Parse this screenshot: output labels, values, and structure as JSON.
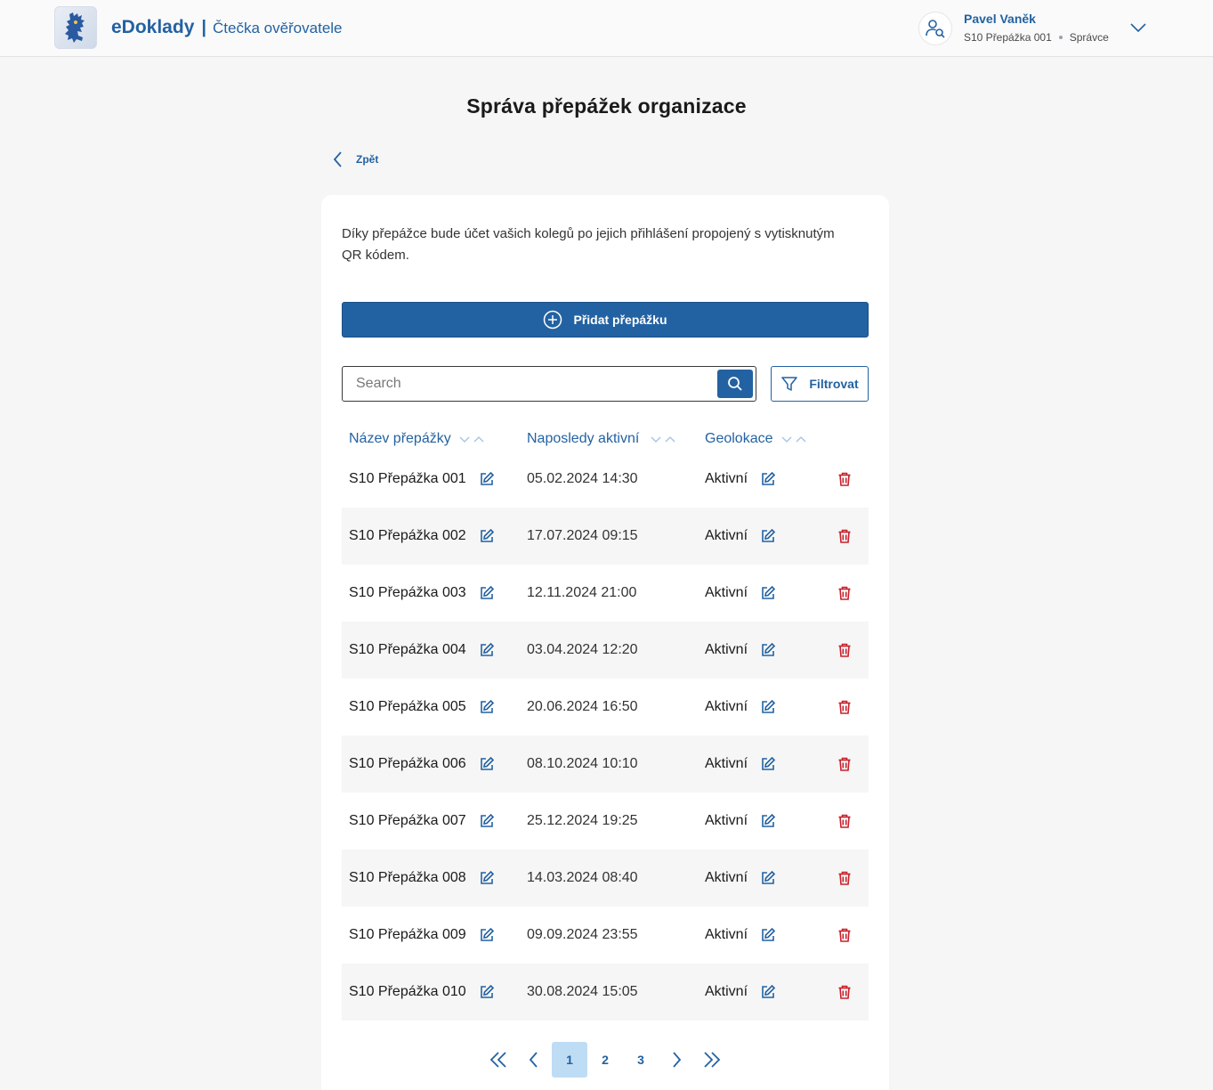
{
  "app": {
    "brand_name": "eDoklady",
    "brand_separator": "|",
    "brand_subtitle": "Čtečka ověřovatele"
  },
  "user": {
    "name": "Pavel Vaněk",
    "counter": "S10 Přepážka 001",
    "role": "Správce"
  },
  "page": {
    "title": "Správa přepážek organizace",
    "back_label": "Zpět",
    "intro": "Díky přepážce bude účet vašich kolegů po jejich přihlášení propojený s vytisknutým QR kódem."
  },
  "actions": {
    "add_label": "Přidat přepážku",
    "search_placeholder": "Search",
    "filter_label": "Filtrovat"
  },
  "table": {
    "columns": [
      "Název přepážky",
      "Naposledy aktivní",
      "Geolokace"
    ],
    "rows": [
      {
        "name": "S10 Přepážka 001",
        "last_active": "05.02.2024 14:30",
        "geo": "Aktivní"
      },
      {
        "name": "S10 Přepážka 002",
        "last_active": "17.07.2024 09:15",
        "geo": "Aktivní"
      },
      {
        "name": "S10 Přepážka 003",
        "last_active": "12.11.2024 21:00",
        "geo": "Aktivní"
      },
      {
        "name": "S10 Přepážka 004",
        "last_active": "03.04.2024 12:20",
        "geo": "Aktivní"
      },
      {
        "name": "S10 Přepážka 005",
        "last_active": "20.06.2024 16:50",
        "geo": "Aktivní"
      },
      {
        "name": "S10 Přepážka 006",
        "last_active": "08.10.2024 10:10",
        "geo": "Aktivní"
      },
      {
        "name": "S10 Přepážka 007",
        "last_active": "25.12.2024 19:25",
        "geo": "Aktivní"
      },
      {
        "name": "S10 Přepážka 008",
        "last_active": "14.03.2024 08:40",
        "geo": "Aktivní"
      },
      {
        "name": "S10 Přepážka 009",
        "last_active": "09.09.2024 23:55",
        "geo": "Aktivní"
      },
      {
        "name": "S10 Přepážka 010",
        "last_active": "30.08.2024 15:05",
        "geo": "Aktivní"
      }
    ]
  },
  "pagination": {
    "pages": [
      "1",
      "2",
      "3"
    ],
    "current": "1"
  },
  "icons": {
    "logo": "lion-coat-of-arms-icon",
    "user": "user-search-icon",
    "expand": "chevron-down-icon",
    "back": "chevron-left-icon",
    "add": "plus-circle-icon",
    "search": "search-icon",
    "filter": "filter-icon",
    "edit": "edit-icon",
    "delete": "trash-icon",
    "sort": "sort-icon"
  },
  "colors": {
    "primary": "#2362a2",
    "danger": "#c8202b",
    "row_alt": "#f6f6f6",
    "active_page": "#bfdcf5"
  }
}
